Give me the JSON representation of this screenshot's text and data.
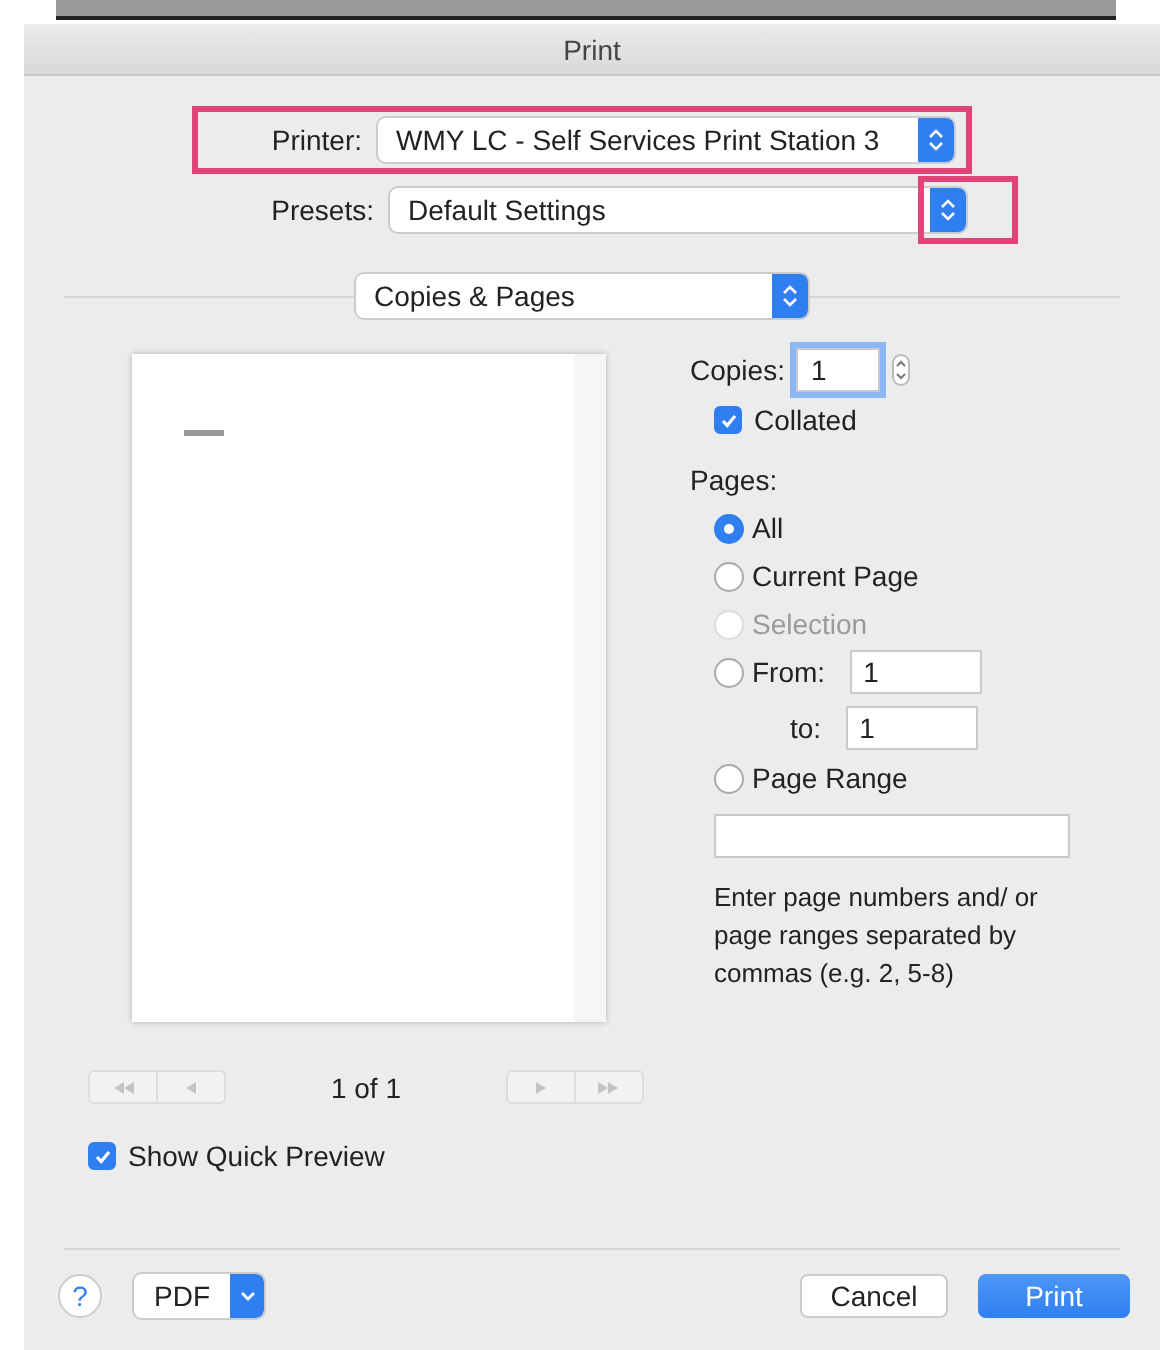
{
  "window": {
    "title": "Print"
  },
  "printer": {
    "label": "Printer:",
    "value": "WMY LC - Self Services Print Station 3",
    "highlighted": true
  },
  "presets": {
    "label": "Presets:",
    "value": "Default Settings",
    "highlighted": true
  },
  "section_menu": {
    "value": "Copies & Pages"
  },
  "copies": {
    "label": "Copies:",
    "value": "1"
  },
  "collated": {
    "label": "Collated",
    "checked": true
  },
  "pages": {
    "label": "Pages:",
    "options": [
      {
        "label": "All",
        "selected": true,
        "disabled": false
      },
      {
        "label": "Current Page",
        "selected": false,
        "disabled": false
      },
      {
        "label": "Selection",
        "selected": false,
        "disabled": true
      },
      {
        "label": "From:",
        "selected": false,
        "disabled": false,
        "kind": "range"
      },
      {
        "label": "Page Range",
        "selected": false,
        "disabled": false,
        "kind": "list"
      }
    ],
    "from": "1",
    "to_label": "to:",
    "to": "1",
    "hint": "Enter page numbers and/ or page ranges separated by commas (e.g. 2, 5-8)"
  },
  "pager": {
    "text": "1 of 1"
  },
  "quick_preview": {
    "label": "Show Quick Preview",
    "checked": true
  },
  "buttons": {
    "help": "?",
    "pdf": "PDF",
    "cancel": "Cancel",
    "print": "Print"
  }
}
